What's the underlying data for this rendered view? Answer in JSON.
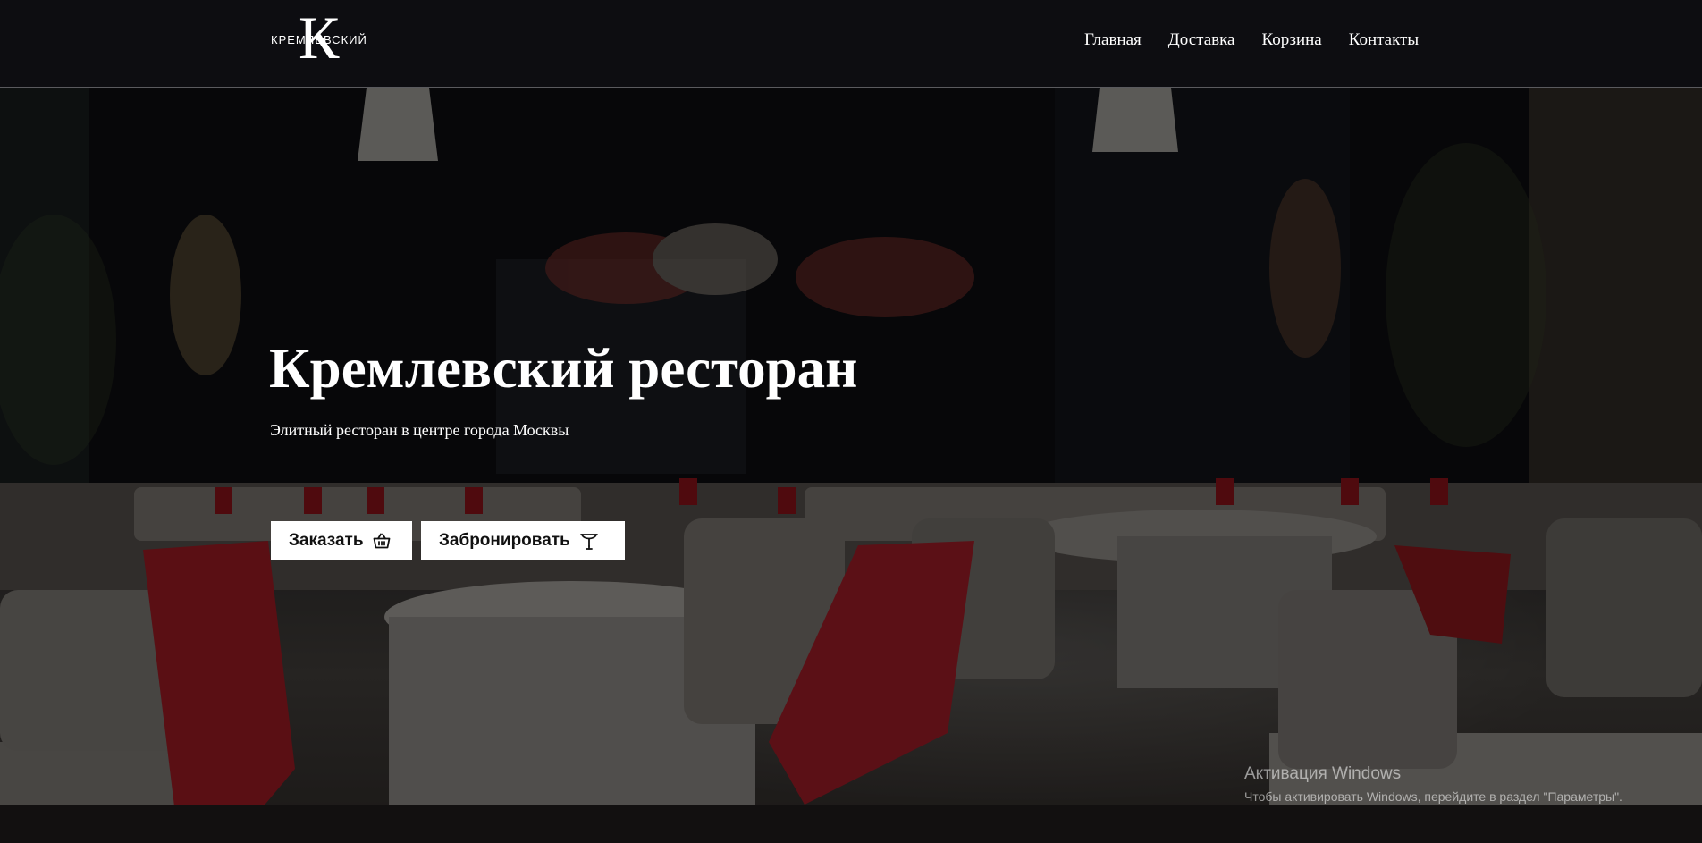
{
  "header": {
    "logo_word": "КРЕМЛЕВСКИЙ",
    "logo_letter": "К",
    "nav": [
      {
        "label": "Главная"
      },
      {
        "label": "Доставка"
      },
      {
        "label": "Корзина"
      },
      {
        "label": "Контакты"
      }
    ]
  },
  "hero": {
    "title": "Кремлевский ресторан",
    "subtitle": "Элитный ресторан в центре города Москвы",
    "order_label": "Заказать",
    "book_label": "Забронировать"
  },
  "watermark": {
    "title": "Активация Windows",
    "text": "Чтобы активировать Windows, перейдите в раздел \"Параметры\"."
  },
  "icons": {
    "order": "basket-icon",
    "book": "cloche-icon"
  },
  "colors": {
    "header_bg": "#0e0e12",
    "button_bg": "#ffffff",
    "text": "#ffffff",
    "accent_red": "#b3121b"
  }
}
